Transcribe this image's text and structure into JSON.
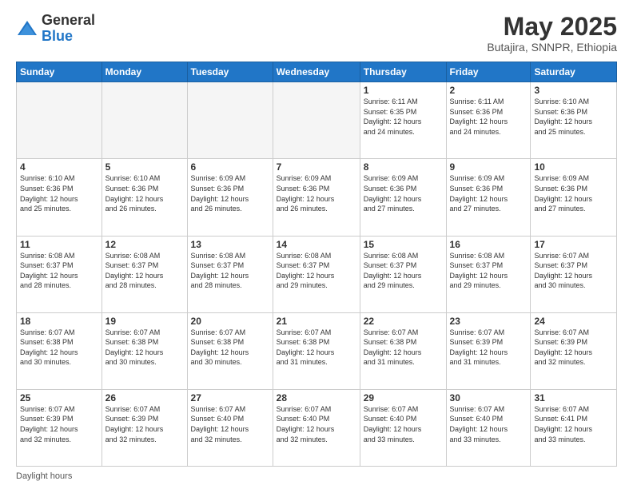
{
  "header": {
    "logo_general": "General",
    "logo_blue": "Blue",
    "month_title": "May 2025",
    "subtitle": "Butajira, SNNPR, Ethiopia"
  },
  "days_of_week": [
    "Sunday",
    "Monday",
    "Tuesday",
    "Wednesday",
    "Thursday",
    "Friday",
    "Saturday"
  ],
  "footer": {
    "label": "Daylight hours"
  },
  "weeks": [
    [
      {
        "day": "",
        "info": ""
      },
      {
        "day": "",
        "info": ""
      },
      {
        "day": "",
        "info": ""
      },
      {
        "day": "",
        "info": ""
      },
      {
        "day": "1",
        "info": "Sunrise: 6:11 AM\nSunset: 6:35 PM\nDaylight: 12 hours\nand 24 minutes."
      },
      {
        "day": "2",
        "info": "Sunrise: 6:11 AM\nSunset: 6:36 PM\nDaylight: 12 hours\nand 24 minutes."
      },
      {
        "day": "3",
        "info": "Sunrise: 6:10 AM\nSunset: 6:36 PM\nDaylight: 12 hours\nand 25 minutes."
      }
    ],
    [
      {
        "day": "4",
        "info": "Sunrise: 6:10 AM\nSunset: 6:36 PM\nDaylight: 12 hours\nand 25 minutes."
      },
      {
        "day": "5",
        "info": "Sunrise: 6:10 AM\nSunset: 6:36 PM\nDaylight: 12 hours\nand 26 minutes."
      },
      {
        "day": "6",
        "info": "Sunrise: 6:09 AM\nSunset: 6:36 PM\nDaylight: 12 hours\nand 26 minutes."
      },
      {
        "day": "7",
        "info": "Sunrise: 6:09 AM\nSunset: 6:36 PM\nDaylight: 12 hours\nand 26 minutes."
      },
      {
        "day": "8",
        "info": "Sunrise: 6:09 AM\nSunset: 6:36 PM\nDaylight: 12 hours\nand 27 minutes."
      },
      {
        "day": "9",
        "info": "Sunrise: 6:09 AM\nSunset: 6:36 PM\nDaylight: 12 hours\nand 27 minutes."
      },
      {
        "day": "10",
        "info": "Sunrise: 6:09 AM\nSunset: 6:36 PM\nDaylight: 12 hours\nand 27 minutes."
      }
    ],
    [
      {
        "day": "11",
        "info": "Sunrise: 6:08 AM\nSunset: 6:37 PM\nDaylight: 12 hours\nand 28 minutes."
      },
      {
        "day": "12",
        "info": "Sunrise: 6:08 AM\nSunset: 6:37 PM\nDaylight: 12 hours\nand 28 minutes."
      },
      {
        "day": "13",
        "info": "Sunrise: 6:08 AM\nSunset: 6:37 PM\nDaylight: 12 hours\nand 28 minutes."
      },
      {
        "day": "14",
        "info": "Sunrise: 6:08 AM\nSunset: 6:37 PM\nDaylight: 12 hours\nand 29 minutes."
      },
      {
        "day": "15",
        "info": "Sunrise: 6:08 AM\nSunset: 6:37 PM\nDaylight: 12 hours\nand 29 minutes."
      },
      {
        "day": "16",
        "info": "Sunrise: 6:08 AM\nSunset: 6:37 PM\nDaylight: 12 hours\nand 29 minutes."
      },
      {
        "day": "17",
        "info": "Sunrise: 6:07 AM\nSunset: 6:37 PM\nDaylight: 12 hours\nand 30 minutes."
      }
    ],
    [
      {
        "day": "18",
        "info": "Sunrise: 6:07 AM\nSunset: 6:38 PM\nDaylight: 12 hours\nand 30 minutes."
      },
      {
        "day": "19",
        "info": "Sunrise: 6:07 AM\nSunset: 6:38 PM\nDaylight: 12 hours\nand 30 minutes."
      },
      {
        "day": "20",
        "info": "Sunrise: 6:07 AM\nSunset: 6:38 PM\nDaylight: 12 hours\nand 30 minutes."
      },
      {
        "day": "21",
        "info": "Sunrise: 6:07 AM\nSunset: 6:38 PM\nDaylight: 12 hours\nand 31 minutes."
      },
      {
        "day": "22",
        "info": "Sunrise: 6:07 AM\nSunset: 6:38 PM\nDaylight: 12 hours\nand 31 minutes."
      },
      {
        "day": "23",
        "info": "Sunrise: 6:07 AM\nSunset: 6:39 PM\nDaylight: 12 hours\nand 31 minutes."
      },
      {
        "day": "24",
        "info": "Sunrise: 6:07 AM\nSunset: 6:39 PM\nDaylight: 12 hours\nand 32 minutes."
      }
    ],
    [
      {
        "day": "25",
        "info": "Sunrise: 6:07 AM\nSunset: 6:39 PM\nDaylight: 12 hours\nand 32 minutes."
      },
      {
        "day": "26",
        "info": "Sunrise: 6:07 AM\nSunset: 6:39 PM\nDaylight: 12 hours\nand 32 minutes."
      },
      {
        "day": "27",
        "info": "Sunrise: 6:07 AM\nSunset: 6:40 PM\nDaylight: 12 hours\nand 32 minutes."
      },
      {
        "day": "28",
        "info": "Sunrise: 6:07 AM\nSunset: 6:40 PM\nDaylight: 12 hours\nand 32 minutes."
      },
      {
        "day": "29",
        "info": "Sunrise: 6:07 AM\nSunset: 6:40 PM\nDaylight: 12 hours\nand 33 minutes."
      },
      {
        "day": "30",
        "info": "Sunrise: 6:07 AM\nSunset: 6:40 PM\nDaylight: 12 hours\nand 33 minutes."
      },
      {
        "day": "31",
        "info": "Sunrise: 6:07 AM\nSunset: 6:41 PM\nDaylight: 12 hours\nand 33 minutes."
      }
    ]
  ]
}
